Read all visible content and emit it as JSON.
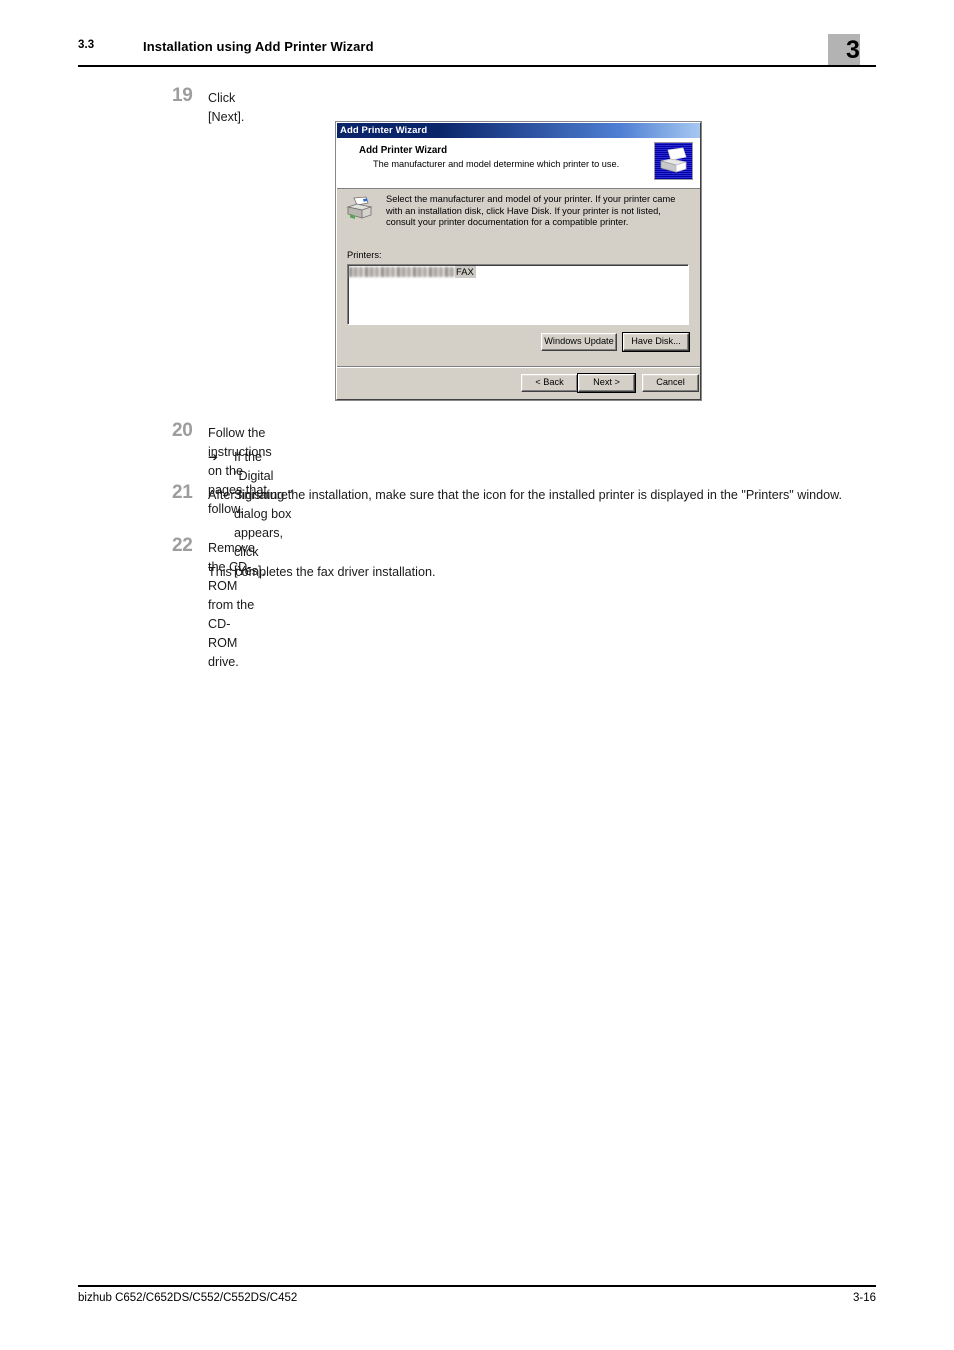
{
  "header": {
    "section_number": "3.3",
    "section_title": "Installation using Add Printer Wizard",
    "chapter_number": "3"
  },
  "steps": [
    {
      "number": "19",
      "text": "Click [Next]."
    },
    {
      "number": "20",
      "text": "Follow the instructions on the pages that follow."
    },
    {
      "number": "21",
      "text": "After finishing the installation, make sure that the icon for the installed printer is displayed in the \"Printers\" window."
    },
    {
      "number": "22",
      "text": "Remove the CD-ROM from the CD-ROM drive."
    }
  ],
  "substeps": {
    "arrow_glyph": "➔",
    "step20_note": "If the \"Digital Signature\" dialog box appears, click [Yes].",
    "step22_note": "This completes the fax driver installation."
  },
  "dialog": {
    "titlebar": "Add Printer Wizard",
    "header_title": "Add Printer Wizard",
    "header_subtitle": "The manufacturer and model determine which printer to use.",
    "body_text": "Select the manufacturer and model of your printer. If your printer came with an installation disk, click Have Disk. If your printer is not listed, consult your printer documentation for a compatible printer.",
    "printers_label": "Printers:",
    "list_items": [
      {
        "redacted_prefix": true,
        "visible_text": "FAX",
        "selected": true
      }
    ],
    "buttons": {
      "windows_update": "Windows Update",
      "have_disk": "Have Disk...",
      "back": "< Back",
      "next": "Next >",
      "cancel": "Cancel"
    },
    "colors": {
      "titlebar_start": "#0a246a",
      "titlebar_end": "#a6c8f0",
      "face": "#d4d0c8",
      "header_panel": "#ffffff",
      "icon_blue": "#0000a8"
    }
  },
  "footer": {
    "product": "bizhub C652/C652DS/C552/C552DS/C452",
    "page_number": "3-16"
  }
}
